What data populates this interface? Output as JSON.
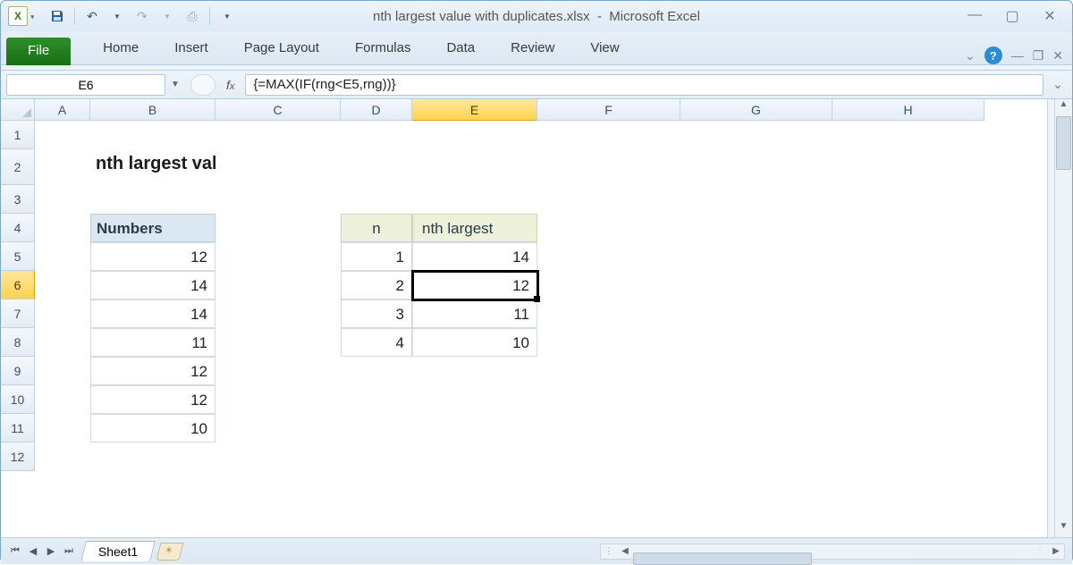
{
  "app": {
    "title_doc": "nth largest value with duplicates.xlsx",
    "title_app": "Microsoft Excel"
  },
  "qat": {
    "excel_letter": "X"
  },
  "ribbon": {
    "file": "File",
    "tabs": [
      "Home",
      "Insert",
      "Page Layout",
      "Formulas",
      "Data",
      "Review",
      "View"
    ]
  },
  "namebox": "E6",
  "formula": "{=MAX(IF(rng<E5,rng))}",
  "columns": [
    "A",
    "B",
    "C",
    "D",
    "E",
    "F",
    "G",
    "H"
  ],
  "rows": [
    "1",
    "2",
    "3",
    "4",
    "5",
    "6",
    "7",
    "8",
    "9",
    "10",
    "11",
    "12"
  ],
  "selected": {
    "col": "E",
    "row": "6"
  },
  "sheet": {
    "title": "nth largest value with duplicates",
    "numbers_header": "Numbers",
    "numbers": [
      "12",
      "14",
      "14",
      "11",
      "12",
      "12",
      "10"
    ],
    "n_header": "n",
    "nth_header": "nth largest",
    "n_values": [
      "1",
      "2",
      "3",
      "4"
    ],
    "nth_values": [
      "14",
      "12",
      "11",
      "10"
    ]
  },
  "tabs": {
    "sheet1": "Sheet1"
  }
}
